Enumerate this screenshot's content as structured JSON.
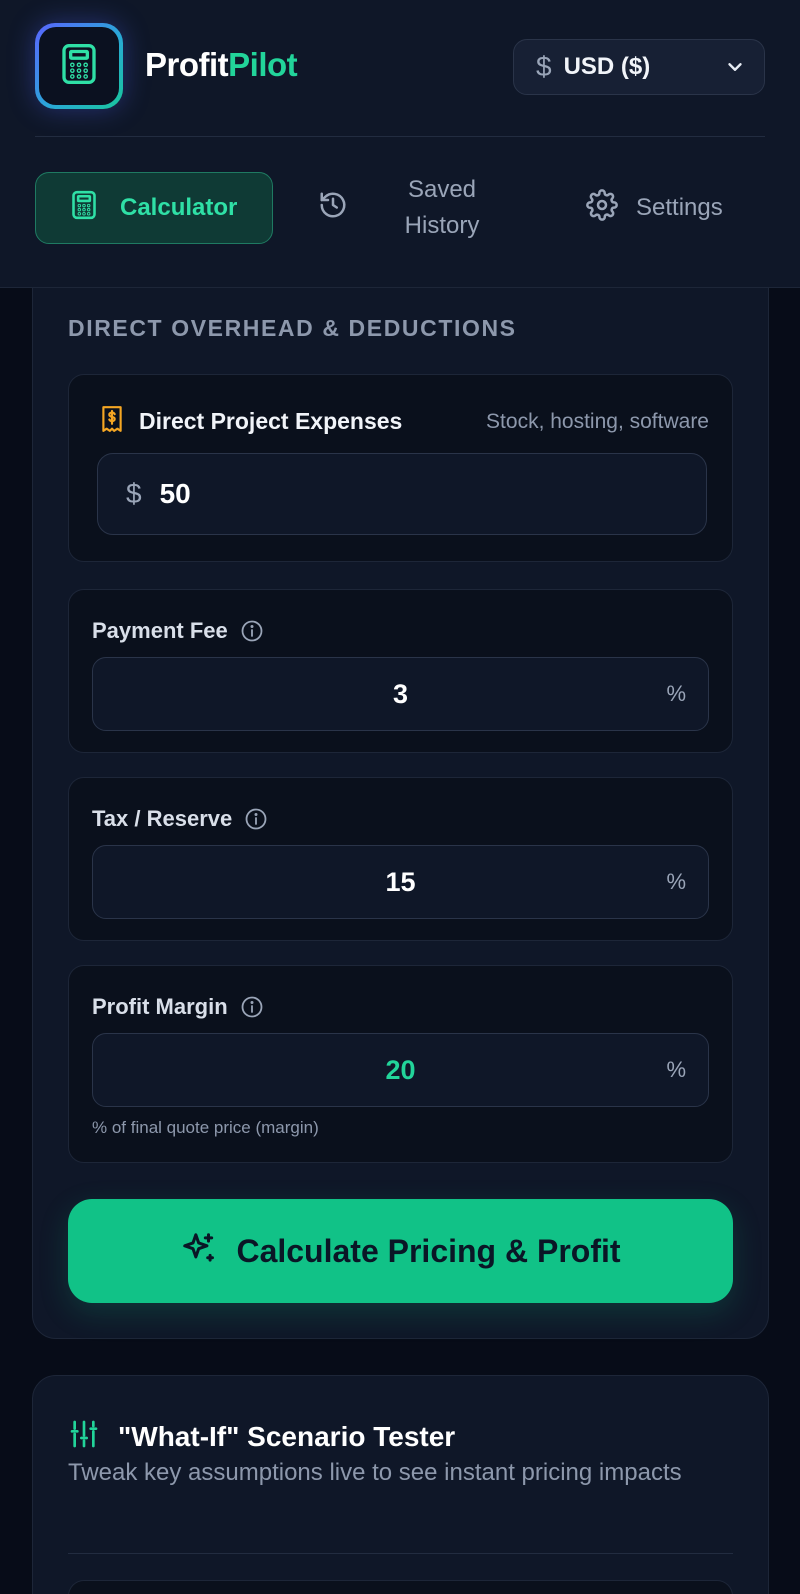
{
  "header": {
    "brand_part1": "Profit",
    "brand_part2": "Pilot",
    "logo_icon": "calculator-icon",
    "currency": {
      "symbol": "$",
      "value": "USD ($)",
      "icon": "chevron-down-icon"
    }
  },
  "nav": {
    "tabs": [
      {
        "label": "Calculator",
        "icon": "calculator-icon",
        "active": true
      },
      {
        "label": "Saved History",
        "icon": "history-icon",
        "active": false
      },
      {
        "label": "Settings",
        "icon": "gear-icon",
        "active": false
      }
    ]
  },
  "overhead": {
    "section_title": "DIRECT OVERHEAD & DEDUCTIONS",
    "expenses": {
      "label": "Direct Project Expenses",
      "hint": "Stock, hosting, software",
      "icon": "receipt-icon",
      "currency_symbol": "$",
      "value": "50"
    },
    "payment_fee": {
      "label": "Payment Fee",
      "value": "3",
      "unit": "%"
    },
    "tax_reserve": {
      "label": "Tax / Reserve",
      "value": "15",
      "unit": "%"
    },
    "profit_margin": {
      "label": "Profit Margin",
      "value": "20",
      "unit": "%",
      "hint": "% of final quote price (margin)"
    },
    "calculate_button": {
      "label": "Calculate Pricing & Profit",
      "icon": "sparkles-icon"
    }
  },
  "what_if": {
    "title": "\"What-If\" Scenario Tester",
    "subtitle": "Tweak key assumptions live to see instant pricing impacts",
    "icon": "sliders-icon"
  },
  "colors": {
    "background": "#070c18",
    "panel": "#0f1728",
    "accent": "#22d49a",
    "button": "#11c287",
    "muted_text": "#8d98ac"
  }
}
